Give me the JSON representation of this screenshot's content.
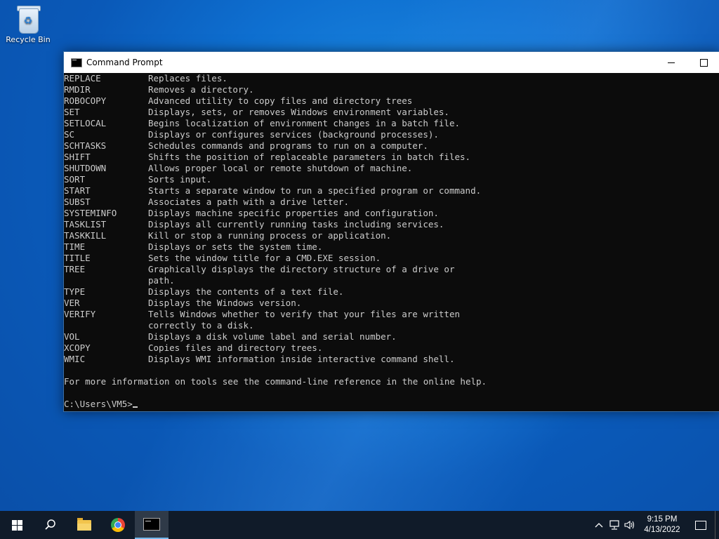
{
  "desktop": {
    "icons": [
      {
        "label": "Recycle Bin",
        "icon": "recycle-bin-icon"
      }
    ]
  },
  "window": {
    "title": "Command Prompt",
    "icon": "command-prompt-icon"
  },
  "console": {
    "commands": [
      {
        "name": "REPLACE",
        "desc": "Replaces files."
      },
      {
        "name": "RMDIR",
        "desc": "Removes a directory."
      },
      {
        "name": "ROBOCOPY",
        "desc": "Advanced utility to copy files and directory trees"
      },
      {
        "name": "SET",
        "desc": "Displays, sets, or removes Windows environment variables."
      },
      {
        "name": "SETLOCAL",
        "desc": "Begins localization of environment changes in a batch file."
      },
      {
        "name": "SC",
        "desc": "Displays or configures services (background processes)."
      },
      {
        "name": "SCHTASKS",
        "desc": "Schedules commands and programs to run on a computer."
      },
      {
        "name": "SHIFT",
        "desc": "Shifts the position of replaceable parameters in batch files."
      },
      {
        "name": "SHUTDOWN",
        "desc": "Allows proper local or remote shutdown of machine."
      },
      {
        "name": "SORT",
        "desc": "Sorts input."
      },
      {
        "name": "START",
        "desc": "Starts a separate window to run a specified program or command."
      },
      {
        "name": "SUBST",
        "desc": "Associates a path with a drive letter."
      },
      {
        "name": "SYSTEMINFO",
        "desc": "Displays machine specific properties and configuration."
      },
      {
        "name": "TASKLIST",
        "desc": "Displays all currently running tasks including services."
      },
      {
        "name": "TASKKILL",
        "desc": "Kill or stop a running process or application."
      },
      {
        "name": "TIME",
        "desc": "Displays or sets the system time."
      },
      {
        "name": "TITLE",
        "desc": "Sets the window title for a CMD.EXE session."
      },
      {
        "name": "TREE",
        "desc": "Graphically displays the directory structure of a drive or",
        "desc2": "path."
      },
      {
        "name": "TYPE",
        "desc": "Displays the contents of a text file."
      },
      {
        "name": "VER",
        "desc": "Displays the Windows version."
      },
      {
        "name": "VERIFY",
        "desc": "Tells Windows whether to verify that your files are written",
        "desc2": "correctly to a disk."
      },
      {
        "name": "VOL",
        "desc": "Displays a disk volume label and serial number."
      },
      {
        "name": "XCOPY",
        "desc": "Copies files and directory trees."
      },
      {
        "name": "WMIC",
        "desc": "Displays WMI information inside interactive command shell."
      }
    ],
    "footer": "For more information on tools see the command-line reference in the online help.",
    "prompt": "C:\\Users\\VM5>"
  },
  "taskbar": {
    "items": [
      {
        "name": "start",
        "icon": "windows-logo-icon"
      },
      {
        "name": "search",
        "icon": "search-icon"
      },
      {
        "name": "file-explorer",
        "icon": "folder-icon"
      },
      {
        "name": "chrome",
        "icon": "chrome-icon"
      },
      {
        "name": "command-prompt",
        "icon": "command-prompt-icon",
        "active": true
      }
    ],
    "tray": {
      "icons": [
        "chevron-up-icon",
        "network-icon",
        "volume-icon"
      ],
      "time": "9:15 PM",
      "date": "4/13/2022"
    }
  }
}
